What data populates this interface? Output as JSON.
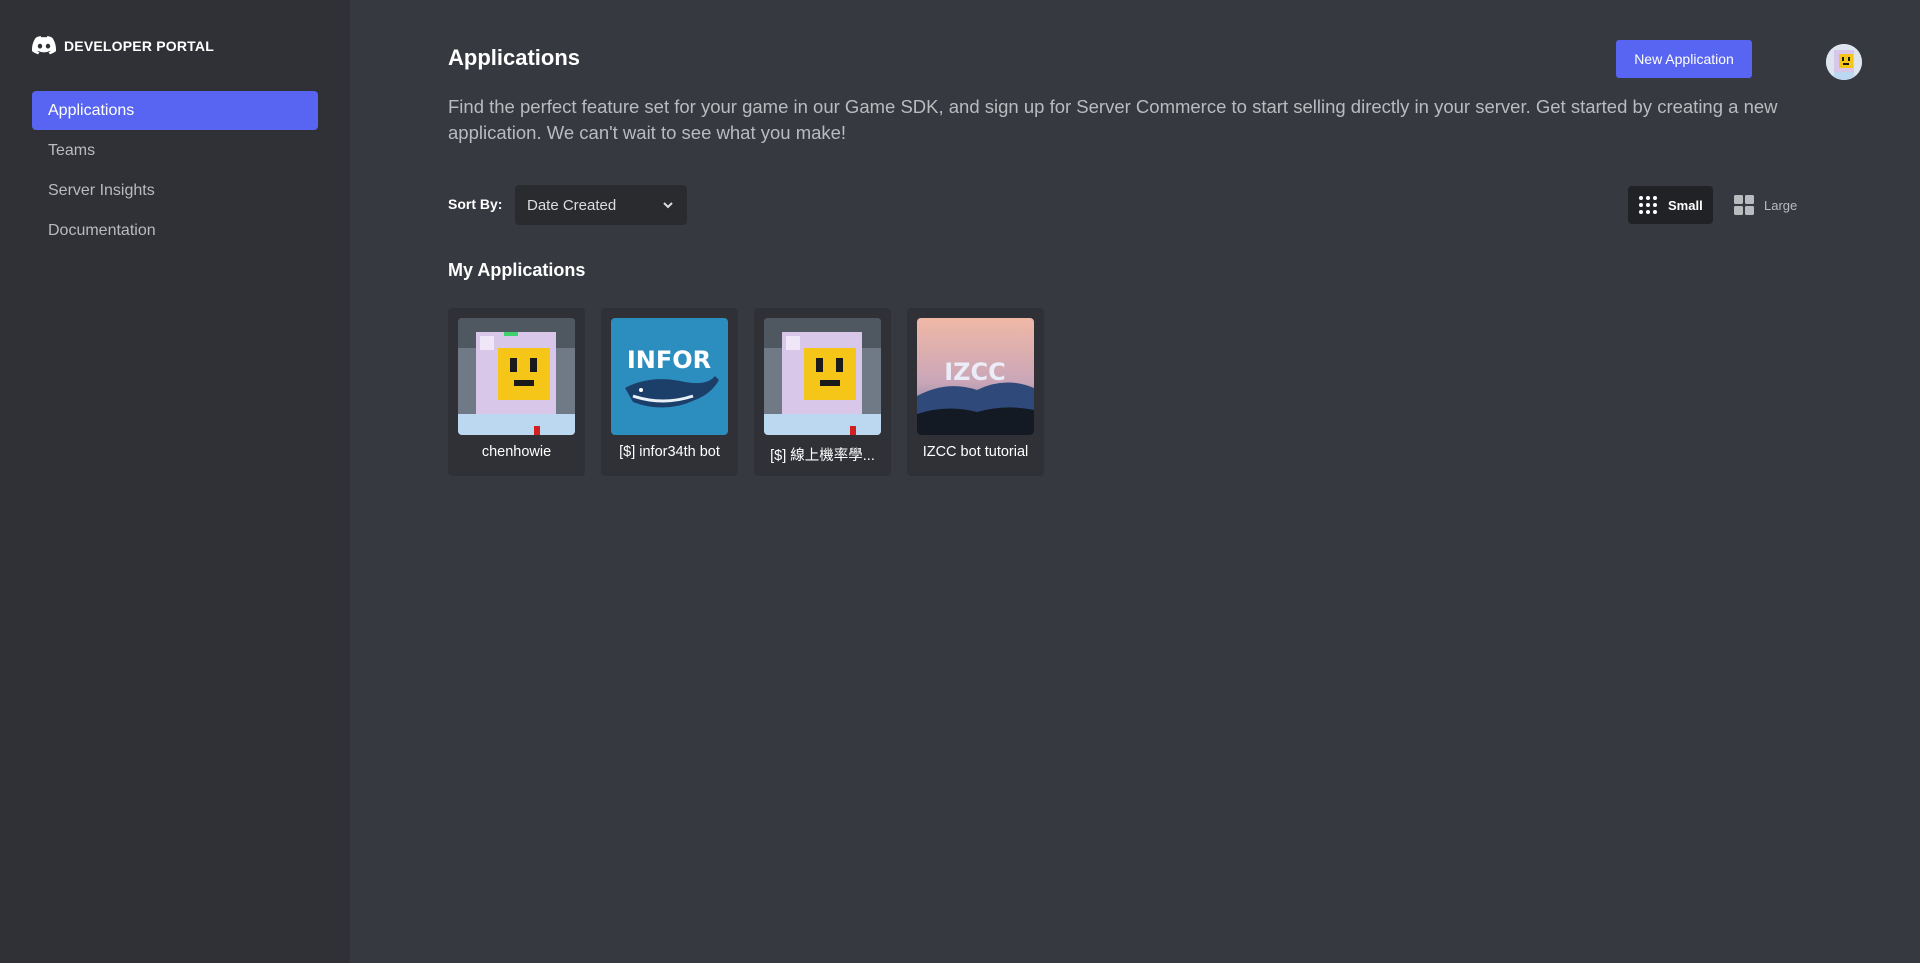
{
  "brand": {
    "title": "DEVELOPER PORTAL"
  },
  "sidebar": {
    "items": [
      {
        "label": "Applications",
        "active": true
      },
      {
        "label": "Teams"
      },
      {
        "label": "Server Insights"
      },
      {
        "label": "Documentation"
      }
    ]
  },
  "header": {
    "title": "Applications",
    "new_button": "New Application",
    "description": "Find the perfect feature set for your game in our Game SDK, and sign up for Server Commerce to start selling directly in your server. Get started by creating a new application. We can't wait to see what you make!"
  },
  "sort": {
    "label": "Sort By:",
    "value": "Date Created"
  },
  "view": {
    "small": "Small",
    "large": "Large",
    "selected": "Small"
  },
  "my_apps": {
    "title": "My Applications",
    "items": [
      {
        "name": "chenhowie",
        "icon": "pixel-character-avatar"
      },
      {
        "name": "[$] infor34th bot",
        "icon": "infor-whale-logo",
        "logo_text": "INFOR"
      },
      {
        "name": "[$] 線上機率學...",
        "icon": "pixel-character-avatar"
      },
      {
        "name": "IZCC bot tutorial",
        "icon": "izcc-mountain-logo",
        "logo_text": "IZCC"
      }
    ]
  },
  "colors": {
    "accent": "#5865f2",
    "background": "#36393f",
    "sidebar": "#2f3136"
  }
}
